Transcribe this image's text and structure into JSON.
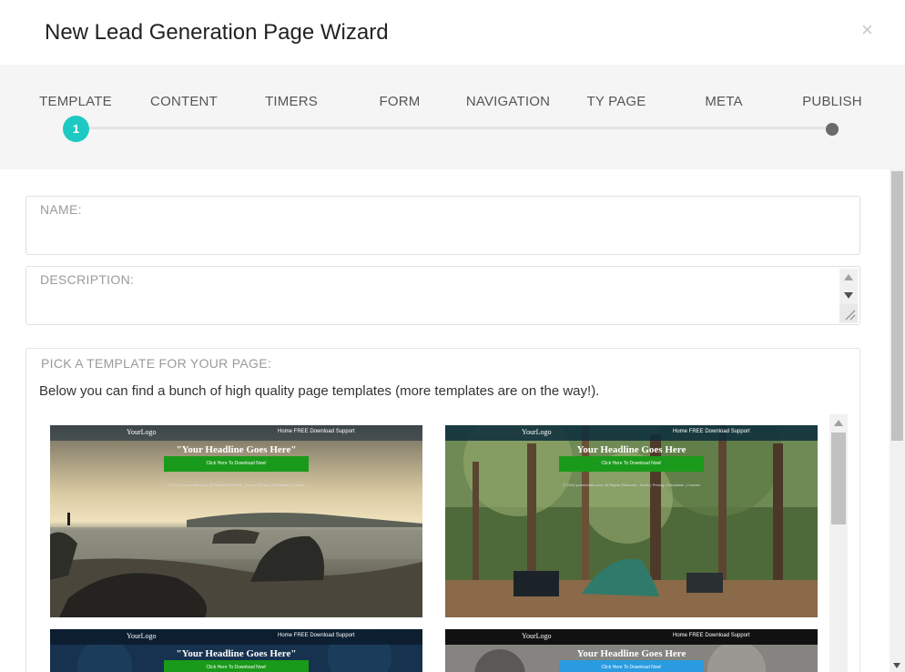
{
  "dialog": {
    "title": "New Lead Generation Page Wizard",
    "close_symbol": "×"
  },
  "steps": [
    {
      "label": "TEMPLATE"
    },
    {
      "label": "CONTENT"
    },
    {
      "label": "TIMERS"
    },
    {
      "label": "FORM"
    },
    {
      "label": "NAVIGATION"
    },
    {
      "label": "TY PAGE"
    },
    {
      "label": "META"
    },
    {
      "label": "PUBLISH"
    }
  ],
  "stepper": {
    "active_step_number": "1",
    "active_color": "#1ec9c3",
    "end_color": "#6b6b6b"
  },
  "form": {
    "name_label": "NAME:",
    "name_value": "",
    "description_label": "DESCRIPTION:",
    "description_value": ""
  },
  "templates": {
    "label": "PICK A TEMPLATE FOR YOUR PAGE:",
    "description": "Below you can find a bunch of high quality page templates (more templates are on the way!).",
    "items": [
      {
        "logo": "YourLogo",
        "nav": "Home   FREE Download   Support",
        "headline": "\"Your Headline Goes Here\"",
        "cta": "Click Here To Download Now!",
        "cta_color": "#1a9a1a",
        "footer": "© 2014 yourdomain.com, All Rights Reserved · Home | Privacy | Disclaimer | Contact",
        "image": "beach-sunset"
      },
      {
        "logo": "YourLogo",
        "nav": "Home   FREE Download   Support",
        "headline": "Your Headline Goes Here",
        "cta": "Click Here To Download Now!",
        "cta_color": "#1a9a1a",
        "footer": "© 2014 yourdomain.com, All Rights Reserved · Home | Privacy | Disclaimer | Contact",
        "image": "forest-camping"
      },
      {
        "logo": "YourLogo",
        "nav": "Home   FREE Download   Support",
        "headline": "\"Your Headline Goes Here\"",
        "cta": "Click Here To Download Now!",
        "cta_color": "#1a9a1a",
        "footer": "",
        "image": "dark-blue"
      },
      {
        "logo": "YourLogo",
        "nav": "Home   FREE Download   Support",
        "headline": "Your Headline Goes Here",
        "cta": "Click Here To Download Now!",
        "cta_color": "#2a9be0",
        "footer": "",
        "image": "rocky-grey"
      }
    ]
  }
}
